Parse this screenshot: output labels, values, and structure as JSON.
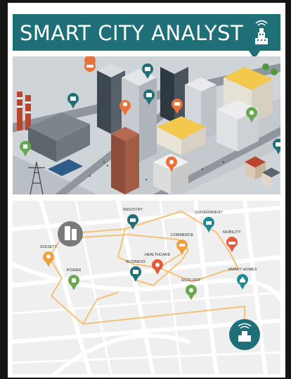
{
  "banner": {
    "title": "SMART CITY ANALYST",
    "color": "#1f6f79",
    "icon": "smart-building-icon"
  },
  "city_scene": {
    "pins": [
      {
        "icon": "car-icon",
        "color": "#e8733a"
      },
      {
        "icon": "briefcase-icon",
        "color": "#1f6f79"
      },
      {
        "icon": "factory-icon",
        "color": "#1f6f79"
      },
      {
        "icon": "bank-icon",
        "color": "#1f6f79"
      },
      {
        "icon": "people-icon",
        "color": "#e8733a"
      },
      {
        "icon": "cart-icon",
        "color": "#e8733a"
      },
      {
        "icon": "leaf-icon",
        "color": "#6aa84f"
      },
      {
        "icon": "house-icon",
        "color": "#1f6f79"
      },
      {
        "icon": "heart-icon",
        "color": "#e8733a"
      },
      {
        "icon": "power-icon",
        "color": "#6aa84f"
      }
    ]
  },
  "network_map": {
    "hub_icon": "smart-building-icon",
    "nodes": [
      {
        "label": "INDUSTRY",
        "icon": "factory-icon",
        "color": "#1f6f79"
      },
      {
        "label": "GOVERNMENT",
        "icon": "bank-icon",
        "color": "#1f8a96"
      },
      {
        "label": "COMMERCE",
        "icon": "cart-icon",
        "color": "#f0a03c"
      },
      {
        "label": "MOBILITY",
        "icon": "car-icon",
        "color": "#e25b3c"
      },
      {
        "label": "HEALTHCARE",
        "icon": "heart-icon",
        "color": "#e25b3c"
      },
      {
        "label": "BUSINESS",
        "icon": "briefcase-icon",
        "color": "#1f6f79"
      },
      {
        "label": "SOCIETY",
        "icon": "people-icon",
        "color": "#f0a03c"
      },
      {
        "label": "POWER",
        "icon": "power-icon",
        "color": "#6aa84f"
      },
      {
        "label": "ECOLOGY",
        "icon": "leaf-icon",
        "color": "#6aa84f"
      },
      {
        "label": "SMART HOMES",
        "icon": "house-icon",
        "color": "#1f8a96"
      }
    ]
  }
}
